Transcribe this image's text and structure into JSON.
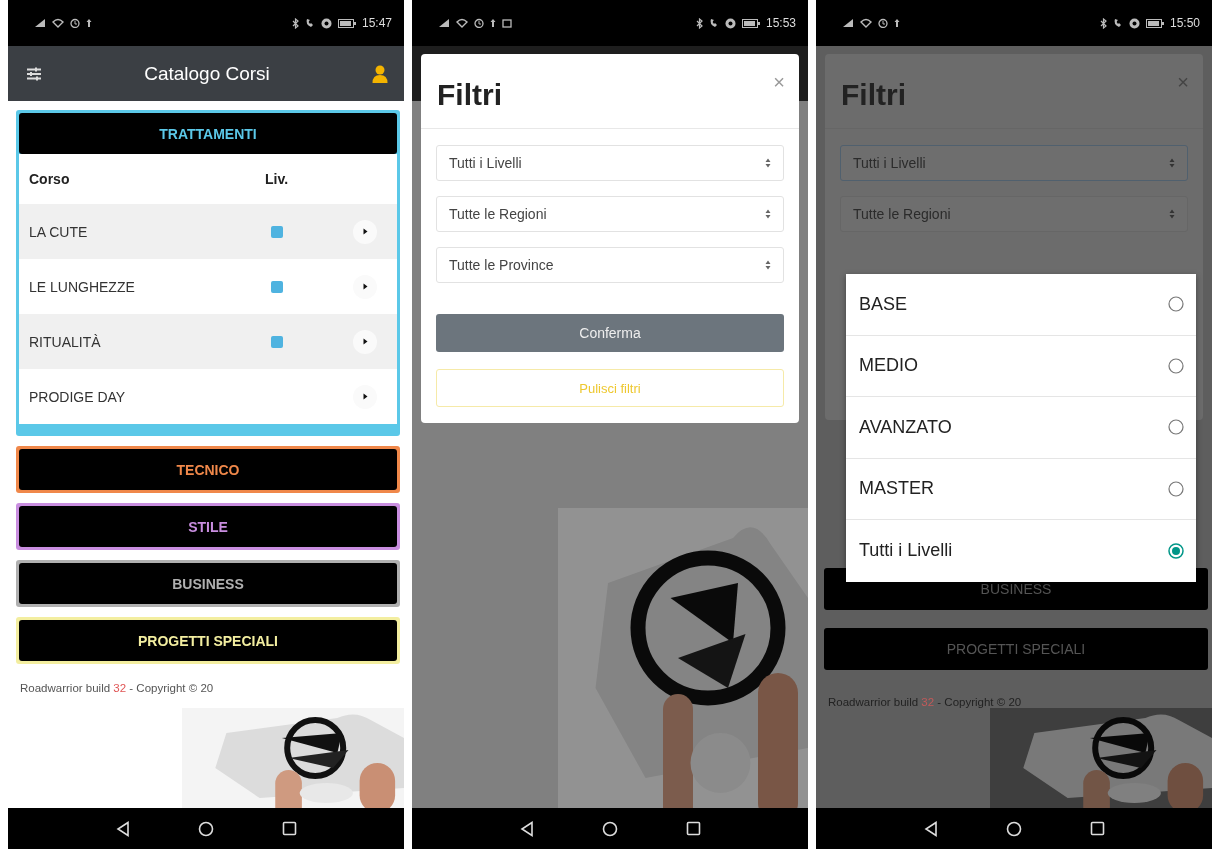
{
  "screens": [
    {
      "kind": "catalog",
      "status_time": "15:47",
      "app_bar": {
        "title": "Catalogo Corsi"
      },
      "categories": [
        {
          "label": "TRATTAMENTI",
          "color": "#5bc8e8",
          "expanded": true,
          "columns": [
            "Corso",
            "Liv."
          ],
          "courses": [
            {
              "name": "LA CUTE",
              "has_level": true
            },
            {
              "name": "LE LUNGHEZZE",
              "has_level": true
            },
            {
              "name": "RITUALITÀ",
              "has_level": true
            },
            {
              "name": "PRODIGE DAY",
              "has_level": false
            }
          ]
        },
        {
          "label": "TECNICO",
          "color": "#f0884a",
          "expanded": false
        },
        {
          "label": "STILE",
          "color": "#c98ee0",
          "expanded": false
        },
        {
          "label": "BUSINESS",
          "color": "#b0b0b0",
          "expanded": false
        },
        {
          "label": "PROGETTI SPECIALI",
          "color": "#f3eea0",
          "expanded": false
        }
      ],
      "footer": {
        "before": "Roadwarrior build ",
        "build": "32",
        "after": " - Copyright © 20"
      }
    },
    {
      "kind": "filters",
      "status_time": "15:53",
      "dialog": {
        "title": "Filtri",
        "close": "×",
        "selects": [
          "Tutti i Livelli",
          "Tutte le Regioni",
          "Tutte le Province"
        ],
        "confirm": "Conferma",
        "clear": "Pulisci filtri"
      }
    },
    {
      "kind": "picker",
      "status_time": "15:50",
      "dialog": {
        "title": "Filtri",
        "close": "×",
        "selects": [
          "Tutti i Livelli",
          "Tutte le Regioni"
        ]
      },
      "options": [
        {
          "label": "BASE",
          "selected": false
        },
        {
          "label": "MEDIO",
          "selected": false
        },
        {
          "label": "AVANZATO",
          "selected": false
        },
        {
          "label": "MASTER",
          "selected": false
        },
        {
          "label": "Tutti i Livelli",
          "selected": true
        }
      ],
      "background_categories": [
        "BUSINESS",
        "PROGETTI SPECIALI"
      ],
      "footer": {
        "before": "Roadwarrior build ",
        "build": "32",
        "after": " - Copyright © 20"
      }
    }
  ]
}
